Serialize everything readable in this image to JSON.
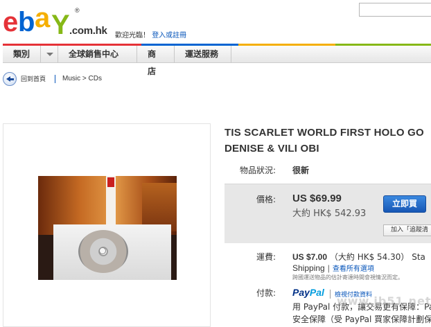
{
  "header": {
    "logo": {
      "e": "e",
      "b": "b",
      "a": "a",
      "y": "Y",
      "reg": "®",
      "domain": ".com.hk"
    },
    "greeting": "歡迎光臨！",
    "signin_link": "登入或註冊"
  },
  "nav": {
    "items": [
      {
        "label": "類別"
      },
      {
        "label": "全球銷售中心"
      },
      {
        "label": "商店"
      },
      {
        "label": "運送服務"
      }
    ]
  },
  "breadcrumb": {
    "back_label": "回到首頁",
    "path": "Music > CDs"
  },
  "item": {
    "title_line1": "TIS SCARLET WORLD FIRST HOLO GO",
    "title_line2": "DENISE & VILI OBI",
    "condition_label": "物品狀況:",
    "condition_value": "很新",
    "price_label": "價格:",
    "price": "US $69.99",
    "price_approx": "大約 HK$ 542.93",
    "buy_button": "立即買",
    "watch_button": "加入「追蹤清",
    "shipping_label": "運費:",
    "shipping_price": "US $7.00",
    "shipping_approx": "（大約 HK$ 54.30）",
    "shipping_tail": "Sta",
    "shipping_method": "Shipping",
    "shipping_more_link": "查看所有選項",
    "shipping_note": "跨國運送物品的估計寄達時間會視情況而定。",
    "payment_label": "付款:",
    "paypal_p1": "Pay",
    "paypal_p2": "Pal",
    "payment_link": "檢視付款資料",
    "payment_line1": "用 PayPal 付款，讓交易更有保障：Pa",
    "payment_line2": "安全保障（受 PayPal 買家保障計劃保障）"
  },
  "watermark": "www.jb51.net"
}
